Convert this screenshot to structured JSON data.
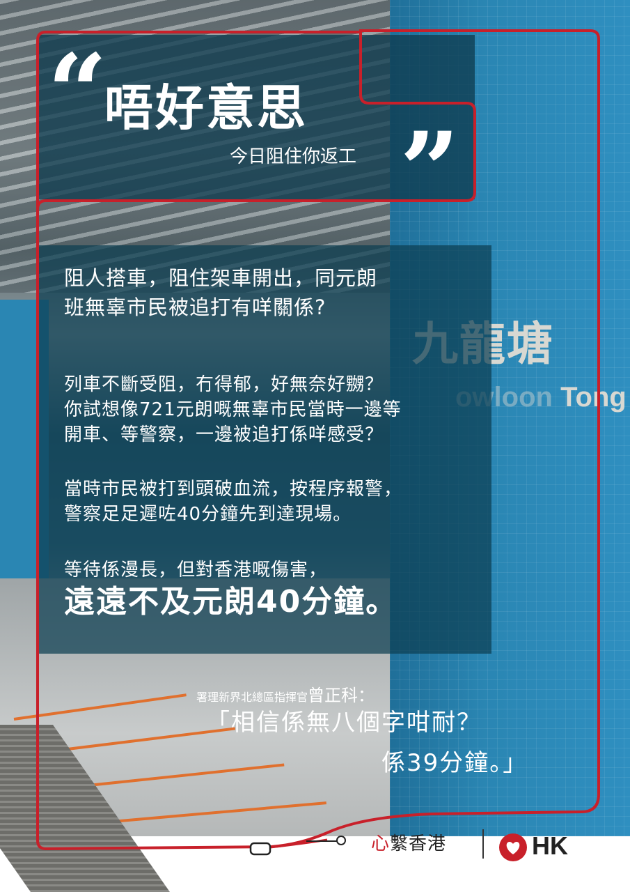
{
  "headline": {
    "quote_open": "“",
    "title": "唔好意思",
    "subtitle": "今日阻住你返工",
    "quote_close": "”"
  },
  "station_sign": {
    "chinese": "九龍塘",
    "english_faded": "owloon",
    "english": "Tong"
  },
  "body": {
    "para1": [
      "阻人搭車，阻住架車開出，同元朗",
      "班無辜市民被追打有咩關係?"
    ],
    "para2": [
      "列車不斷受阻，冇得郁，好無奈好嬲？",
      "你試想像721元朗嘅無辜市民當時一邊等",
      "開車、等警察，一邊被追打係咩感受？"
    ],
    "para3": [
      "當時市民被打到頭破血流，按程序報警，",
      "警察足足遲咗40分鐘先到達現場。"
    ],
    "para4": "等待係漫長，但對香港嘅傷害，",
    "highlight": "遠遠不及元朗40分鐘。"
  },
  "attribution": {
    "role": "署理新界北總區指揮官",
    "name": "曾正科",
    "colon": "：",
    "quote_line1": "「相信係無八個字咁耐？",
    "quote_line2": "係39分鐘。」"
  },
  "footer": {
    "slogan_first": "心",
    "slogan_rest": "繫香港",
    "logo_text": "HK"
  },
  "colors": {
    "frame_red": "#c8202a",
    "overlay_teal": "#0c3e52",
    "text_white": "#ffffff",
    "pillar_blue": "#2a86b3"
  },
  "icons": {
    "heart_logo": "heart-in-circle-icon",
    "train_route": "train-route-icon"
  }
}
